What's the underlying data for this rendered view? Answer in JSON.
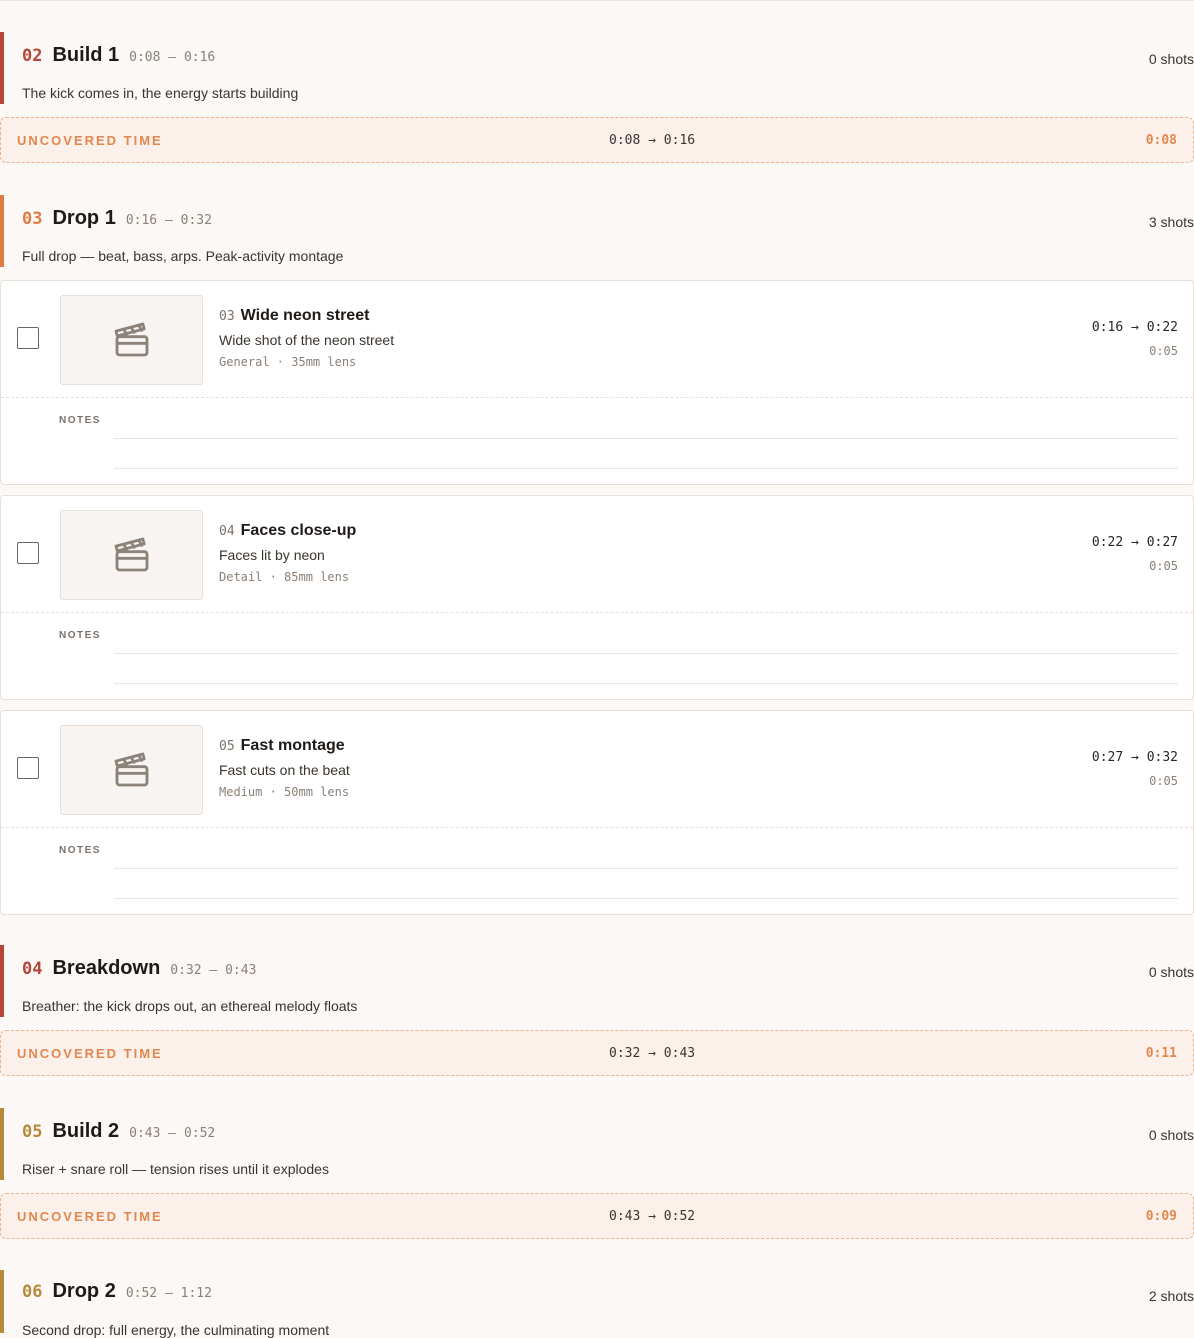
{
  "sections": [
    {
      "num": "02",
      "title": "Build 1",
      "range": "0:08 — 0:16",
      "shots": "0 shots",
      "desc": "The kick comes in, the energy starts building",
      "accent": "#b5473a"
    },
    {
      "num": "03",
      "title": "Drop 1",
      "range": "0:16 — 0:32",
      "shots": "3 shots",
      "desc": "Full drop — beat, bass, arps. Peak-activity montage",
      "accent": "#e07b45"
    },
    {
      "num": "04",
      "title": "Breakdown",
      "range": "0:32 — 0:43",
      "shots": "0 shots",
      "desc": "Breather: the kick drops out, an ethereal melody floats",
      "accent": "#b5473a"
    },
    {
      "num": "05",
      "title": "Build 2",
      "range": "0:43 — 0:52",
      "shots": "0 shots",
      "desc": "Riser + snare roll — tension rises until it explodes",
      "accent": "#b8893a"
    },
    {
      "num": "06",
      "title": "Drop 2",
      "range": "0:52 — 1:12",
      "shots": "2 shots",
      "desc": "Second drop: full energy, the culminating moment",
      "accent": "#b8893a"
    }
  ],
  "uncovered": [
    {
      "label": "UNCOVERED TIME",
      "range": "0:08 → 0:16",
      "duration": "0:08"
    },
    {
      "label": "UNCOVERED TIME",
      "range": "0:32 → 0:43",
      "duration": "0:11"
    },
    {
      "label": "UNCOVERED TIME",
      "range": "0:43 → 0:52",
      "duration": "0:09"
    }
  ],
  "shots": [
    {
      "num": "03",
      "title": "Wide neon street",
      "desc": "Wide shot of the neon street",
      "meta": "General · 35mm lens",
      "range": "0:16 → 0:22",
      "duration": "0:05",
      "notes_label": "NOTES"
    },
    {
      "num": "04",
      "title": "Faces close-up",
      "desc": "Faces lit by neon",
      "meta": "Detail · 85mm lens",
      "range": "0:22 → 0:27",
      "duration": "0:05",
      "notes_label": "NOTES"
    },
    {
      "num": "05",
      "title": "Fast montage",
      "desc": "Fast cuts on the beat",
      "meta": "Medium · 50mm lens",
      "range": "0:27 → 0:32",
      "duration": "0:05",
      "notes_label": "NOTES"
    }
  ],
  "icons": {
    "thumb": "clapperboard-icon"
  },
  "colors": {
    "uncovered": "#e2874e",
    "bg": "#fbf8f5"
  }
}
